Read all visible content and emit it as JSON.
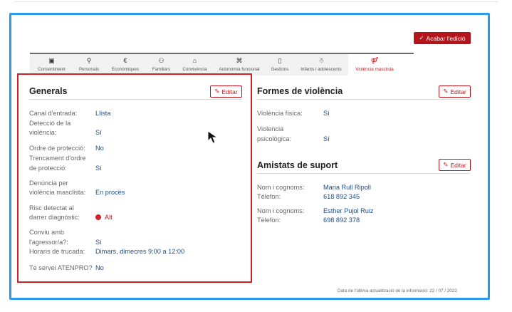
{
  "header": {
    "finish_edit_label": "Acabar l'edició"
  },
  "tabs": [
    {
      "label": "Consentiment",
      "icon": "id-card-icon"
    },
    {
      "label": "Personals",
      "icon": "person-icon"
    },
    {
      "label": "Econòmiques",
      "icon": "euro-icon"
    },
    {
      "label": "Familiars",
      "icon": "family-icon"
    },
    {
      "label": "Convivència",
      "icon": "home-icon"
    },
    {
      "label": "Autonomia funcional",
      "icon": "puzzle-icon"
    },
    {
      "label": "Gestions",
      "icon": "clipboard-icon"
    },
    {
      "label": "Infants i adolescents",
      "icon": "children-icon"
    },
    {
      "label": "Violència masclista",
      "icon": "gender-icon",
      "active": true
    }
  ],
  "generals": {
    "title": "Generals",
    "edit_label": "Editar",
    "canal_label": "Canal d'entrada:",
    "canal_value": "Llista",
    "deteccio_label_1": "Detecció de la",
    "deteccio_label_2": "violència:",
    "deteccio_value": "Sí",
    "ordre_label": "Ordre de protecció:",
    "ordre_value": "No",
    "trencament_label_1": "Trencament d'ordre",
    "trencament_label_2": "de protecció:",
    "trencament_value": "Sí",
    "denuncia_label_1": "Denúncia per",
    "denuncia_label_2": "violència masclista:",
    "denuncia_value": "En procés",
    "risc_label_1": "Risc detectat al",
    "risc_label_2": "darrer diagnòstic:",
    "risc_value": "Alt",
    "conviu_label_1": "Conviu amb",
    "conviu_label_2": "l'agressor/a?:",
    "conviu_value": "Sí",
    "horaris_label": "Horaris de trucada:",
    "horaris_value": "Dimars, dimecres 9:00 a 12:00",
    "atenpro_label": "Té servei ATENPRO?",
    "atenpro_value": "No"
  },
  "formes": {
    "title": "Formes de violència",
    "edit_label": "Editar",
    "fisica_label": "Violència física:",
    "fisica_value": "Sí",
    "psicologica_label_1": "Violencia",
    "psicologica_label_2": "psicològica:",
    "psicologica_value": "Sí"
  },
  "amistats": {
    "title": "Amistats de suport",
    "edit_label": "Editar",
    "contacts": [
      {
        "name_label": "Nom i cognoms:",
        "name": "Maria Rull Ripoll",
        "phone_label": "Télefon:",
        "phone": "618 892 345"
      },
      {
        "name_label": "Nom i cognoms:",
        "name": "Esther Pujol Ruiz",
        "phone_label": "Télefon:",
        "phone": "698 892 378"
      }
    ]
  },
  "footer": {
    "last_update": "Data de l'última actualització de la informació: 22 / 07 / 2022"
  },
  "colors": {
    "accent": "#c0141c",
    "frame": "#2c9be6",
    "highlight": "#d42027",
    "value_text": "#1a4e8a"
  }
}
